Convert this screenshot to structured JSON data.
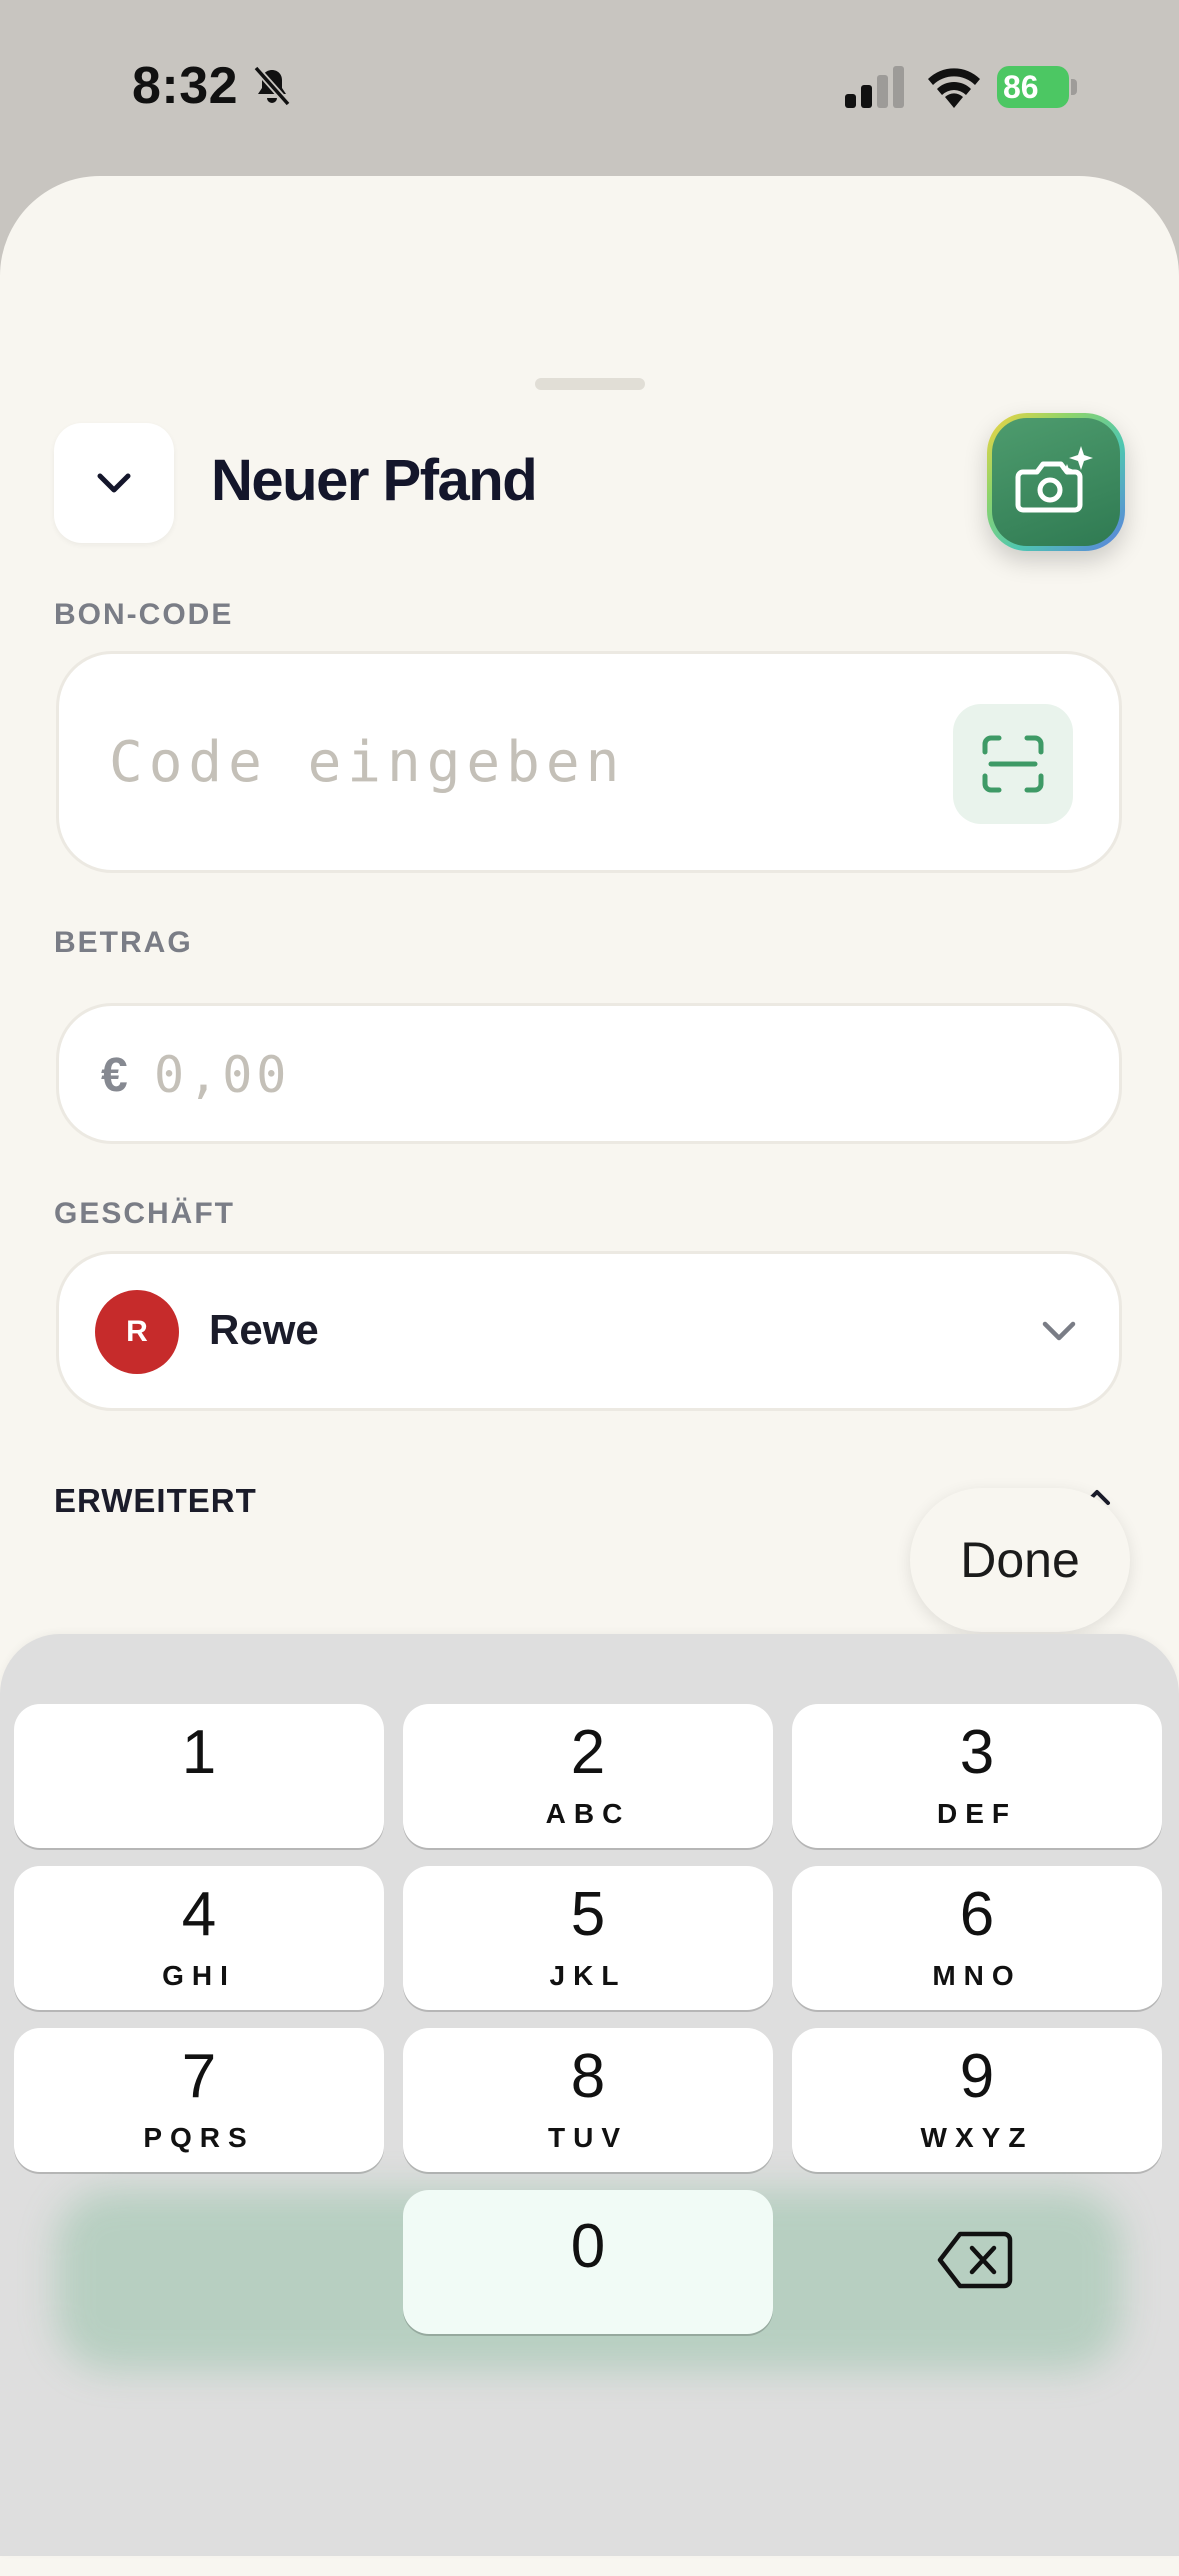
{
  "status_bar": {
    "time": "8:32",
    "battery": "86"
  },
  "sheet": {
    "title": "Neuer Pfand"
  },
  "bon_code": {
    "label": "BON-CODE",
    "placeholder": "Code eingeben"
  },
  "betrag": {
    "label": "BETRAG",
    "currency": "€",
    "placeholder": "0,00"
  },
  "geschaeft": {
    "label": "GESCHÄFT",
    "avatar_letter": "R",
    "value": "Rewe",
    "avatar_color": "#c62b2b"
  },
  "erweitert": {
    "label": "ERWEITERT"
  },
  "keyboard": {
    "done_label": "Done",
    "keys": [
      {
        "num": "1",
        "letters": ""
      },
      {
        "num": "2",
        "letters": "ABC"
      },
      {
        "num": "3",
        "letters": "DEF"
      },
      {
        "num": "4",
        "letters": "GHI"
      },
      {
        "num": "5",
        "letters": "JKL"
      },
      {
        "num": "6",
        "letters": "MNO"
      },
      {
        "num": "7",
        "letters": "PQRS"
      },
      {
        "num": "8",
        "letters": "TUV"
      },
      {
        "num": "9",
        "letters": "WXYZ"
      },
      {
        "num": "0",
        "letters": ""
      }
    ]
  },
  "icons": {
    "collapse": "chevron-down-icon",
    "ai_camera": "camera-sparkle-icon",
    "scan": "scan-icon",
    "store_dropdown": "chevron-down-icon",
    "delete": "backspace-icon"
  },
  "colors": {
    "accent_green": "#2f7a52",
    "sheet_bg": "#f8f6f0",
    "rewe_red": "#c62b2b"
  }
}
